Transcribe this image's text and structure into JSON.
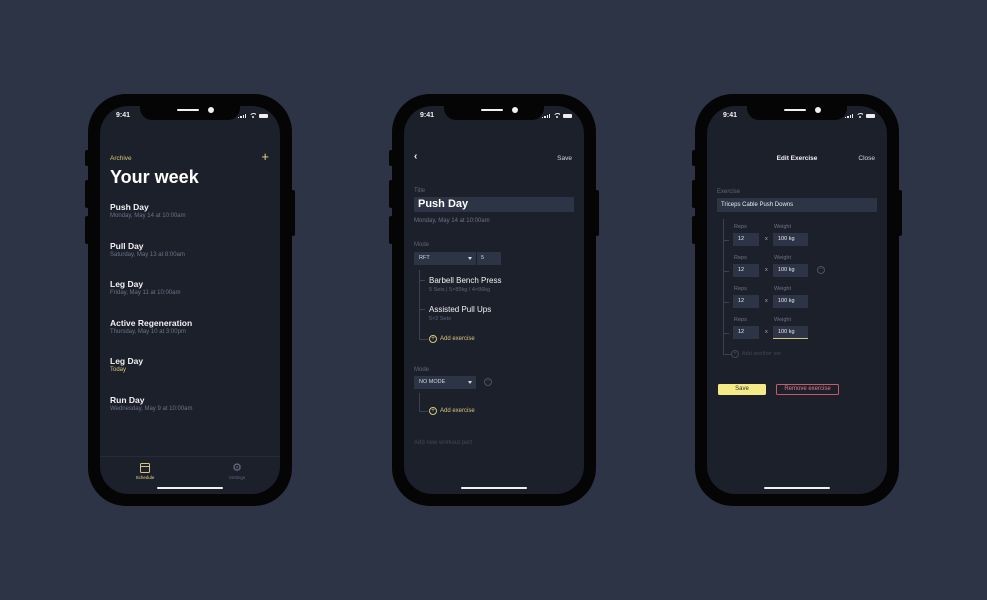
{
  "status_time": "9:41",
  "colors": {
    "background": "#2c3445",
    "screen": "#1c202b",
    "accent": "#e6d98a",
    "danger": "#c45a6a"
  },
  "schedule_screen": {
    "archive_label": "Archive",
    "add_icon": "plus-icon",
    "title": "Your week",
    "days": [
      {
        "name": "Push Day",
        "date": "Monday, May 14 at 10:00am",
        "today": false
      },
      {
        "name": "Pull Day",
        "date": "Saturday, May 13 at 8:00am",
        "today": false
      },
      {
        "name": "Leg Day",
        "date": "Friday, May 11 at 10:00am",
        "today": false
      },
      {
        "name": "Active Regeneration",
        "date": "Thursday, May 10 at 3:00pm",
        "today": false
      },
      {
        "name": "Leg Day",
        "date": "Today",
        "today": true
      },
      {
        "name": "Run Day",
        "date": "Wednesday, May 9 at 10:00am",
        "today": false
      }
    ],
    "tabs": [
      {
        "label": "Schedule",
        "icon": "calendar-icon",
        "active": true
      },
      {
        "label": "Settings",
        "icon": "gear-icon",
        "active": false
      }
    ]
  },
  "workout_screen": {
    "back_icon": "chevron-left-icon",
    "save_label": "Save",
    "title_label": "Title",
    "title_value": "Push Day",
    "date": "Monday, May 14 at 10:00am",
    "parts": [
      {
        "mode_label": "Mode",
        "mode_value": "RFT",
        "rounds_value": "5",
        "exercises": [
          {
            "name": "Barbell Bench Press",
            "detail": "5 Sets | 5×85kg / 4×86kg"
          },
          {
            "name": "Assisted Pull Ups",
            "detail": "5×2 Sets"
          }
        ],
        "add_exercise_label": "Add exercise"
      },
      {
        "mode_label": "Mode",
        "mode_value": "NO MODE",
        "exercises": [],
        "add_exercise_label": "Add exercise"
      }
    ],
    "add_part_label": "Add new workout part"
  },
  "edit_exercise_screen": {
    "title": "Edit Exercise",
    "close_label": "Close",
    "exercise_label": "Exercise",
    "exercise_value": "Triceps Cable Push Downs",
    "reps_label": "Reps",
    "weight_label": "Weight",
    "times_symbol": "x",
    "sets": [
      {
        "reps": "12",
        "weight": "100 kg"
      },
      {
        "reps": "12",
        "weight": "100 kg"
      },
      {
        "reps": "12",
        "weight": "100 kg"
      },
      {
        "reps": "12",
        "weight": "100 kg"
      }
    ],
    "add_set_label": "Add another set",
    "save_label": "Save",
    "remove_label": "Remove exercise"
  }
}
